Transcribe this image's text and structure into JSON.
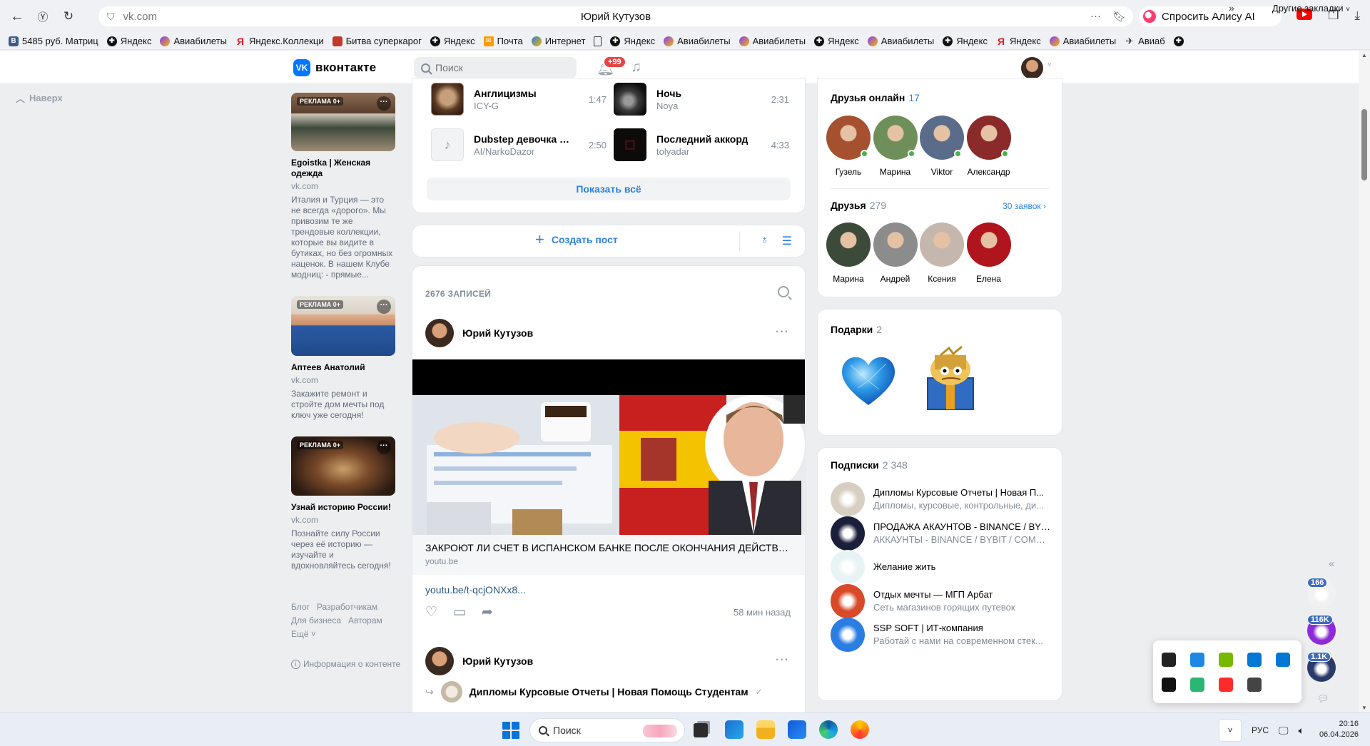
{
  "browser": {
    "url": "vk.com",
    "page_title": "Юрий Кутузов",
    "alice_label": "Спросить Алису AI",
    "bookmarks": [
      {
        "label": "5485 руб. Матриц",
        "icon": "vk"
      },
      {
        "label": "Яндекс",
        "icon": "black"
      },
      {
        "label": "Авиабилеты",
        "icon": "purple"
      },
      {
        "label": "Яндекс.Коллекци",
        "icon": "red"
      },
      {
        "label": "Битва суперкарог",
        "icon": "game"
      },
      {
        "label": "Яндекс",
        "icon": "black"
      },
      {
        "label": "Почта",
        "icon": "mail"
      },
      {
        "label": "Интернет",
        "icon": "globe"
      },
      {
        "label": "",
        "icon": "doc"
      },
      {
        "label": "Яндекс",
        "icon": "black"
      },
      {
        "label": "Авиабилеты",
        "icon": "purple"
      },
      {
        "label": "Авиабилеты",
        "icon": "purple"
      },
      {
        "label": "Яндекс",
        "icon": "black"
      },
      {
        "label": "Авиабилеты",
        "icon": "purple"
      },
      {
        "label": "Яндекс",
        "icon": "black"
      },
      {
        "label": "Яндекс",
        "icon": "red"
      },
      {
        "label": "Авиабилеты",
        "icon": "purple"
      },
      {
        "label": "Авиаб",
        "icon": "plane"
      },
      {
        "label": "",
        "icon": "black"
      }
    ],
    "bookmarks_more": "»",
    "other_bookmarks": "Другие закладки"
  },
  "vk": {
    "logo_text": "вконтакте",
    "search_placeholder": "Поиск",
    "notif_badge": "+99",
    "to_top": "Наверх"
  },
  "ads": [
    {
      "tag": "РЕКЛАМА 0+",
      "title": "Egoistka | Женская одежда",
      "domain": "vk.com",
      "text": "Италия и Турция — это не всегда «дорого». Мы привозим те же трендовые коллекции, которые вы видите в бутиках, но без огромных наценок. В нашем Клубе модниц: - прямые..."
    },
    {
      "tag": "РЕКЛАМА 0+",
      "title": "Аптеев Анатолий",
      "domain": "vk.com",
      "text": "Закажите ремонт и стройте дом мечты под ключ уже сегодня!"
    },
    {
      "tag": "РЕКЛАМА 0+",
      "title": "Узнай историю России!",
      "domain": "vk.com",
      "text": "Познайте силу России через её историю — изучайте и вдохновляйтесь сегодня!"
    }
  ],
  "footer": {
    "blog": "Блог",
    "devs": "Разработчикам",
    "business": "Для бизнеса",
    "authors": "Авторам",
    "more": "Ещё ˅",
    "content_info": "Информация о контенте"
  },
  "music": {
    "tracks": [
      {
        "name": "Англицизмы",
        "artist": "ICY-G",
        "duration": "1:47"
      },
      {
        "name": "Ночь",
        "artist": "Noya",
        "duration": "2:31"
      },
      {
        "name": "Dubstep девочка К...",
        "artist": "AI/NarkoDazor",
        "duration": "2:50"
      },
      {
        "name": "Последний аккорд",
        "artist": "tolyadar",
        "duration": "4:33"
      }
    ],
    "show_all": "Показать всё"
  },
  "create_post": {
    "label": "Создать пост"
  },
  "feed": {
    "count": "2676 ЗАПИСЕЙ",
    "post1": {
      "author": "Юрий Кутузов",
      "link_title": "ЗАКРОЮТ ЛИ СЧЕТ В ИСПАНСКОМ БАНКЕ ПОСЛЕ ОКОНЧАНИЯ ДЕЙСТВИЯ ...",
      "link_domain": "youtu.be",
      "url": "youtu.be/t-qcjONXx8...",
      "time": "58 мин назад"
    },
    "post2": {
      "author": "Юрий Кутузов",
      "repost_from": "Дипломы Курсовые Отчеты | Новая Помощь Студентам",
      "verified": "✓"
    }
  },
  "friends_online": {
    "title": "Друзья онлайн",
    "count": "17",
    "people": [
      {
        "name": "Гузель",
        "color": "#a5502f"
      },
      {
        "name": "Марина",
        "color": "#6f8f5a"
      },
      {
        "name": "Viktor",
        "color": "#5a6c8a"
      },
      {
        "name": "Александр",
        "color": "#8b2a2a"
      }
    ]
  },
  "friends": {
    "title": "Друзья",
    "count": "279",
    "requests": "30 заявок",
    "people": [
      {
        "name": "Марина",
        "color": "#3c4a3a"
      },
      {
        "name": "Андрей",
        "color": "#8c8c8c"
      },
      {
        "name": "Ксения",
        "color": "#c6b7ae"
      },
      {
        "name": "Елена",
        "color": "#b0141c"
      }
    ]
  },
  "gifts": {
    "title": "Подарки",
    "count": "2"
  },
  "subscriptions": {
    "title": "Подписки",
    "count": "2 348",
    "items": [
      {
        "name": "Дипломы Курсовые Отчеты | Новая П...",
        "desc": "Дипломы, курсовые, контрольные, ди...",
        "color": "#d8cfc3"
      },
      {
        "name": "ПРОДАЖА АКАУНТОВ - BINANCE / BYB...",
        "desc": "АККАУНТЫ - BINANCE / BYBIT / COMM...",
        "color": "#1b1f3a"
      },
      {
        "name": "Желание жить",
        "desc": "",
        "color": "#e8f3f6"
      },
      {
        "name": "Отдых мечты — МГП Арбат",
        "desc": "Сеть магазинов горящих путевок",
        "color": "#d94a2a"
      },
      {
        "name": "SSP SOFT | ИТ-компания",
        "desc": "Работай с нами на современном стек...",
        "color": "#2a7de1"
      }
    ]
  },
  "side_widgets": [
    {
      "badge": "166",
      "color": "#f1f1f1"
    },
    {
      "badge": "116K",
      "color": "#8e2bd8"
    },
    {
      "badge": "1.1K",
      "color": "#2a3a6a"
    }
  ],
  "tray": {
    "icons": [
      "#222",
      "#1e88e5",
      "#76b900",
      "#0078d4",
      "#0078d4",
      "#111",
      "#2bb673",
      "#ff2b2b",
      "#444"
    ]
  },
  "taskbar": {
    "search": "Поиск",
    "lang": "РУС",
    "time": "20:16",
    "date": "06.04.2026"
  }
}
